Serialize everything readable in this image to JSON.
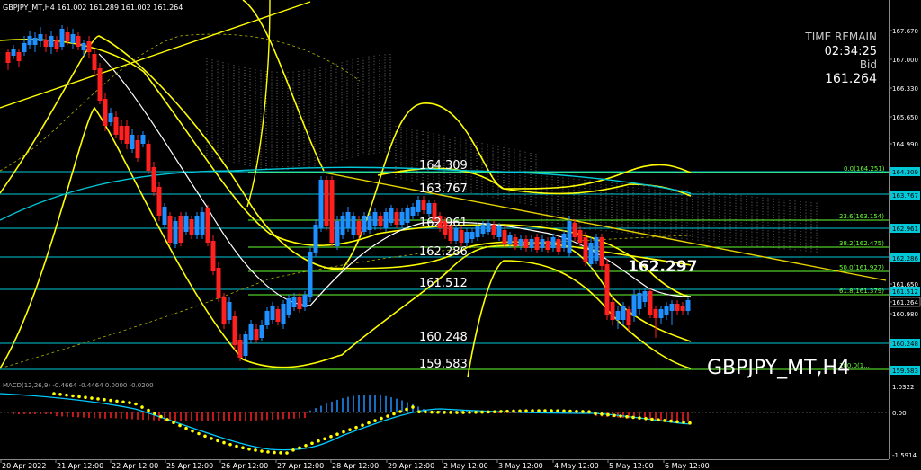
{
  "header": {
    "symbol_line": "GBPJPY_MT,H4  161.002 161.289 161.002 161.264"
  },
  "info": {
    "time_remain_label": "TIME REMAIN",
    "time_remain": "02:34:25",
    "bid_label": "Bid",
    "bid": "161.264"
  },
  "watermark": "GBPJPY_MT,H4",
  "price_axis": {
    "labels": [
      "167.670",
      "167.000",
      "166.330",
      "165.650",
      "164.990",
      "164.309",
      "163.767",
      "162.961",
      "162.286",
      "161.650",
      "161.512",
      "161.264",
      "160.980",
      "160.248",
      "159.583"
    ]
  },
  "levels": [
    {
      "name": "level-164309",
      "label": "164.309",
      "color": "#00c8d8"
    },
    {
      "name": "level-163767",
      "label": "163.767",
      "color": "#00c8d8"
    },
    {
      "name": "level-162961",
      "label": "162.961",
      "color": "#00c8d8"
    },
    {
      "name": "level-162286",
      "label": "162.286",
      "color": "#00c8d8"
    },
    {
      "name": "level-161512",
      "label": "161.512",
      "color": "#00c8d8"
    },
    {
      "name": "level-160248",
      "label": "160.248",
      "color": "#00c8d8"
    },
    {
      "name": "level-159583",
      "label": "159.583",
      "color": "#00c8d8"
    }
  ],
  "fibo": [
    {
      "label": "0.0(164.251)"
    },
    {
      "label": "23.6(163.154)"
    },
    {
      "label": "38.2(162.475)"
    },
    {
      "label": "50.0(161.927)"
    },
    {
      "label": "61.8(161.379)"
    },
    {
      "label": "100.0(1..."
    }
  ],
  "big_price": "162.297",
  "macd": {
    "label": "MACD(12,26,9) -0.4664 -0.4464 0.0000 -0.0200",
    "axis_labels": [
      "1.0322",
      "0.00",
      "-1.5914"
    ]
  },
  "time_axis": [
    "20 Apr 2022",
    "21 Apr 12:00",
    "22 Apr 12:00",
    "25 Apr 12:00",
    "26 Apr 12:00",
    "27 Apr 12:00",
    "28 Apr 12:00",
    "29 Apr 12:00",
    "2 May 12:00",
    "3 May 12:00",
    "4 May 12:00",
    "5 May 12:00",
    "6 May 12:00"
  ],
  "colors": {
    "up": "#1e90ff",
    "down": "#ff2020",
    "level": "#00c8d8",
    "yellow": "#ffff00",
    "fibo": "#66ff33"
  }
}
